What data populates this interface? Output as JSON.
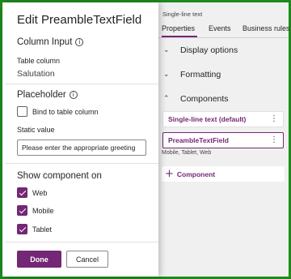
{
  "flyout": {
    "title": "Edit PreambleTextField",
    "column_input": {
      "heading": "Column Input",
      "info_glyph": "i",
      "table_column_label": "Table column",
      "table_column_value": "Salutation"
    },
    "placeholder": {
      "heading": "Placeholder",
      "info_glyph": "i",
      "bind_label": "Bind to table column",
      "bind_checked": false,
      "static_label": "Static value",
      "static_value": "Please enter the appropriate greeting"
    },
    "show_on": {
      "heading": "Show component on",
      "options": [
        {
          "label": "Web",
          "checked": true
        },
        {
          "label": "Mobile",
          "checked": true
        },
        {
          "label": "Tablet",
          "checked": true
        }
      ]
    },
    "buttons": {
      "done": "Done",
      "cancel": "Cancel"
    }
  },
  "properties_pane": {
    "control_type": "Single-line text",
    "tabs": [
      "Properties",
      "Events",
      "Business rules"
    ],
    "active_tab": "Properties",
    "sections": {
      "display_options": "Display options",
      "formatting": "Formatting",
      "components": "Components"
    },
    "chevrons": {
      "collapsed": "⌄",
      "expanded": "⌃"
    },
    "component_items": [
      {
        "label": "Single-line text (default)",
        "menu": "⋮"
      },
      {
        "label": "PreambleTextField",
        "menu": "⋮"
      }
    ],
    "component_devices": "Mobile, Tablet, Web",
    "add_component": {
      "glyph": "+",
      "label": "Component"
    }
  },
  "colors": {
    "accent": "#742774",
    "frame": "#1e8a1e"
  }
}
